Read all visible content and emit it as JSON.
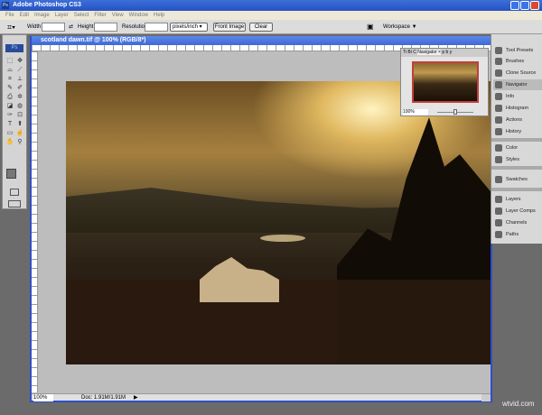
{
  "app": {
    "title": "Adobe Photoshop CS3",
    "logo": "Ps"
  },
  "menu": [
    "File",
    "Edit",
    "Image",
    "Layer",
    "Select",
    "Filter",
    "View",
    "Window",
    "Help"
  ],
  "options": {
    "width_label": "Width:",
    "height_label": "Height:",
    "resolution_label": "Resolution:",
    "units": "pixels/inch",
    "front_image": "Front Image",
    "clear": "Clear",
    "workspace": "Workspace ▼"
  },
  "document": {
    "title": "scotland dawn.tif @ 100% (RGB/8*)",
    "zoom": "100%",
    "doc_size": "Doc: 1.91M/1.91M"
  },
  "navigator": {
    "tabs": [
      "Ti",
      "Bi",
      "C",
      "Navigator ×",
      "p",
      "b",
      "y"
    ],
    "zoom": "100%"
  },
  "panels": [
    {
      "label": "Tool Presets",
      "icon": "tool-presets-icon"
    },
    {
      "label": "Brushes",
      "icon": "brush-icon"
    },
    {
      "label": "Clone Source",
      "icon": "clone-source-icon"
    },
    {
      "label": "Navigator",
      "icon": "navigator-icon",
      "selected": true
    },
    {
      "label": "Info",
      "icon": "info-icon"
    },
    {
      "label": "Histogram",
      "icon": "histogram-icon"
    },
    {
      "label": "Actions",
      "icon": "actions-icon"
    },
    {
      "label": "History",
      "icon": "history-icon"
    },
    {
      "label": "Color",
      "icon": "color-icon"
    },
    {
      "label": "Styles",
      "icon": "styles-icon"
    },
    {
      "label": "Swatches",
      "icon": "swatches-icon"
    },
    {
      "label": "Layers",
      "icon": "layers-icon"
    },
    {
      "label": "Layer Comps",
      "icon": "layer-comps-icon"
    },
    {
      "label": "Channels",
      "icon": "channels-icon"
    },
    {
      "label": "Paths",
      "icon": "paths-icon"
    }
  ],
  "watermark": "wtvid.com"
}
